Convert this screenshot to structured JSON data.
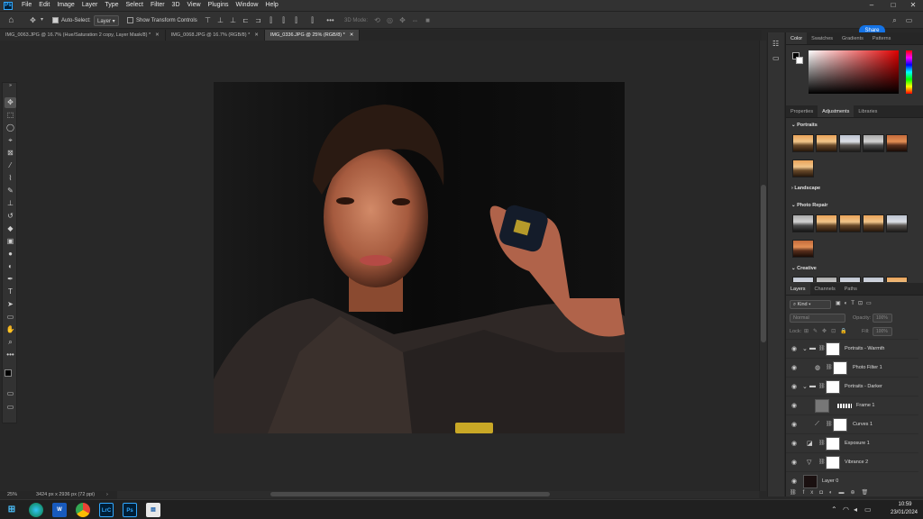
{
  "menubar": {
    "app_icon": "Ps",
    "items": [
      "File",
      "Edit",
      "Image",
      "Layer",
      "Type",
      "Select",
      "Filter",
      "3D",
      "View",
      "Plugins",
      "Window",
      "Help"
    ]
  },
  "options": {
    "auto_select_label": "Auto-Select:",
    "auto_select_value": "Layer",
    "show_transform_label": "Show Transform Controls",
    "mode_3d_label": "3D Mode:",
    "share_label": "Share"
  },
  "tabs": [
    {
      "label": "IMG_0063.JPG @ 16.7% (Hue/Saturation 2 copy, Layer Mask/8) *"
    },
    {
      "label": "IMG_0068.JPG @ 16.7% (RGB/8) *"
    },
    {
      "label": "IMG_0336.JPG @ 25% (RGB/8) *"
    }
  ],
  "status": {
    "zoom": "25%",
    "doc_size": "3424 px x 2936 px (72 ppi)"
  },
  "color_panel": {
    "tabs": [
      "Color",
      "Swatches",
      "Gradients",
      "Patterns"
    ]
  },
  "adjust_panel": {
    "tabs": [
      "Properties",
      "Adjustments",
      "Libraries"
    ],
    "sections": [
      "Portraits",
      "Landscape",
      "Photo Repair",
      "Creative"
    ]
  },
  "layers_panel": {
    "tabs": [
      "Layers",
      "Channels",
      "Paths"
    ],
    "filter_kind": "Kind",
    "blend_mode": "Normal",
    "opacity_label": "Opacity:",
    "opacity_value": "100%",
    "lock_label": "Lock:",
    "fill_label": "Fill:",
    "fill_value": "100%",
    "layers": [
      {
        "name": "Portraits - Warmth"
      },
      {
        "name": "Photo Filter 1"
      },
      {
        "name": "Portraits - Darker"
      },
      {
        "name": "Frame 1"
      },
      {
        "name": "Curves 1"
      },
      {
        "name": "Exposure 1"
      },
      {
        "name": "Vibrance 2"
      },
      {
        "name": "Layer 0"
      }
    ]
  },
  "taskbar": {
    "time": "10:59",
    "date": "23/01/2024"
  },
  "colors": {
    "accent": "#1473e6",
    "ps_blue": "#31a8ff"
  }
}
